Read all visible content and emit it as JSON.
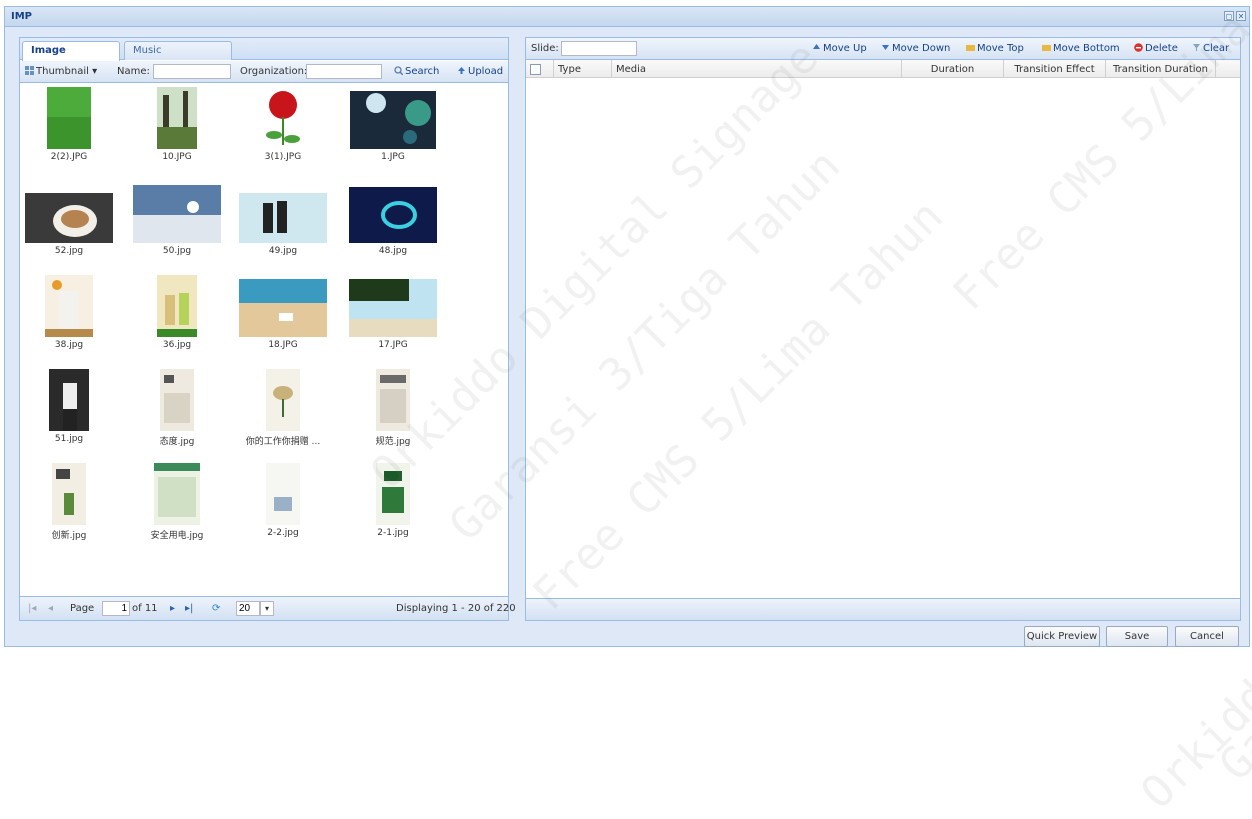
{
  "window": {
    "title": "IMP"
  },
  "left": {
    "tabs": [
      "Image",
      "Music"
    ],
    "toolbar": {
      "view": "Thumbnail",
      "name_label": "Name:",
      "org_label": "Organization:",
      "search": "Search",
      "upload": "Upload"
    },
    "images": [
      {
        "name": "2(2).JPG",
        "kind": "grass"
      },
      {
        "name": "10.JPG",
        "kind": "trees"
      },
      {
        "name": "3(1).JPG",
        "kind": "rose"
      },
      {
        "name": "1.JPG",
        "kind": "bokeh"
      },
      {
        "name": "52.jpg",
        "kind": "coffee"
      },
      {
        "name": "50.jpg",
        "kind": "snow"
      },
      {
        "name": "49.jpg",
        "kind": "phones"
      },
      {
        "name": "48.jpg",
        "kind": "space"
      },
      {
        "name": "38.jpg",
        "kind": "milk"
      },
      {
        "name": "36.jpg",
        "kind": "drinks"
      },
      {
        "name": "18.JPG",
        "kind": "beach"
      },
      {
        "name": "17.JPG",
        "kind": "palm"
      },
      {
        "name": "51.jpg",
        "kind": "person"
      },
      {
        "name": "态度.jpg",
        "kind": "poster1"
      },
      {
        "name": "你的工作你捐赠 ...",
        "kind": "poster2"
      },
      {
        "name": "规范.jpg",
        "kind": "poster3"
      },
      {
        "name": "创新.jpg",
        "kind": "poster4"
      },
      {
        "name": "安全用电.jpg",
        "kind": "poster5"
      },
      {
        "name": "2-2.jpg",
        "kind": "poster6"
      },
      {
        "name": "2-1.jpg",
        "kind": "poster7"
      }
    ],
    "pager": {
      "page_label": "Page",
      "page": "1",
      "of": "of 11",
      "page_size": "20",
      "display": "Displaying 1 - 20 of 220"
    }
  },
  "right": {
    "toolbar": {
      "slide_label": "Slide:",
      "move_up": "Move Up",
      "move_down": "Move Down",
      "move_top": "Move Top",
      "move_bottom": "Move Bottom",
      "delete": "Delete",
      "clear": "Clear"
    },
    "columns": [
      "Type",
      "Media",
      "Duration",
      "Transition Effect",
      "Transition Duration"
    ]
  },
  "buttons": {
    "quick_preview": "Quick Preview",
    "save": "Save",
    "cancel": "Cancel"
  },
  "watermark": [
    "Orkiddo Digital Signage",
    "Garansi 3/Tiga Tahun",
    "Free CMS 5/Lima Tahun"
  ],
  "colors": {
    "accent": "#15428b",
    "border": "#99bbe8",
    "panel_bg": "#dfe8f6"
  }
}
